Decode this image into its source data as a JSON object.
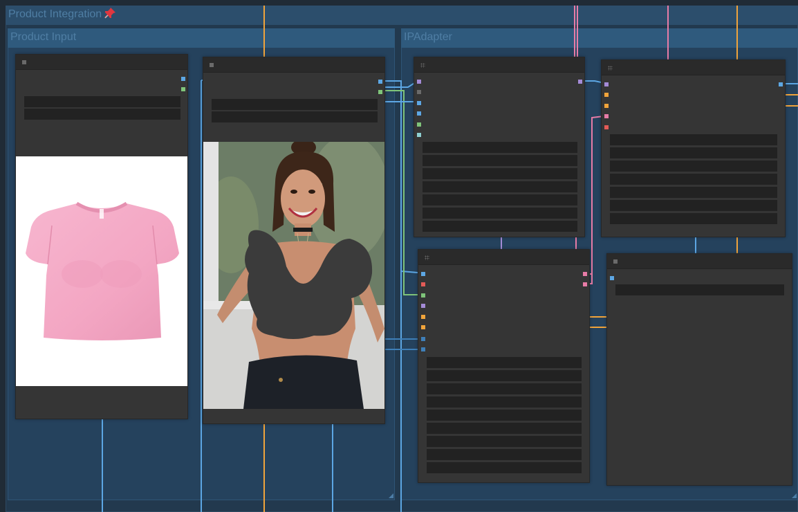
{
  "groups": {
    "main_title": "Product Integration",
    "product_input_title": "Product Input",
    "ipadapter_title": "IPAdapter"
  },
  "icons": {
    "pin": "pushpin-icon",
    "collapse": "collapse-toggle-icon",
    "grip": "node-grip-icon",
    "resize": "group-resize-icon"
  },
  "colors": {
    "link_blue": "#5da7e4",
    "link_orange": "#f1a43b",
    "link_pink": "#e87ca7",
    "link_green": "#7fc47a",
    "link_violet": "#a48bd6",
    "slot_red": "#e35b57",
    "slot_grey": "#6b6b6b",
    "slot_teal": "#8fd0d2",
    "group_header": "#2f5a7d",
    "node_body": "#353535"
  },
  "images": {
    "product": "pink-crop-top-tshirt",
    "person": "smiling-woman-with-masked-top"
  }
}
